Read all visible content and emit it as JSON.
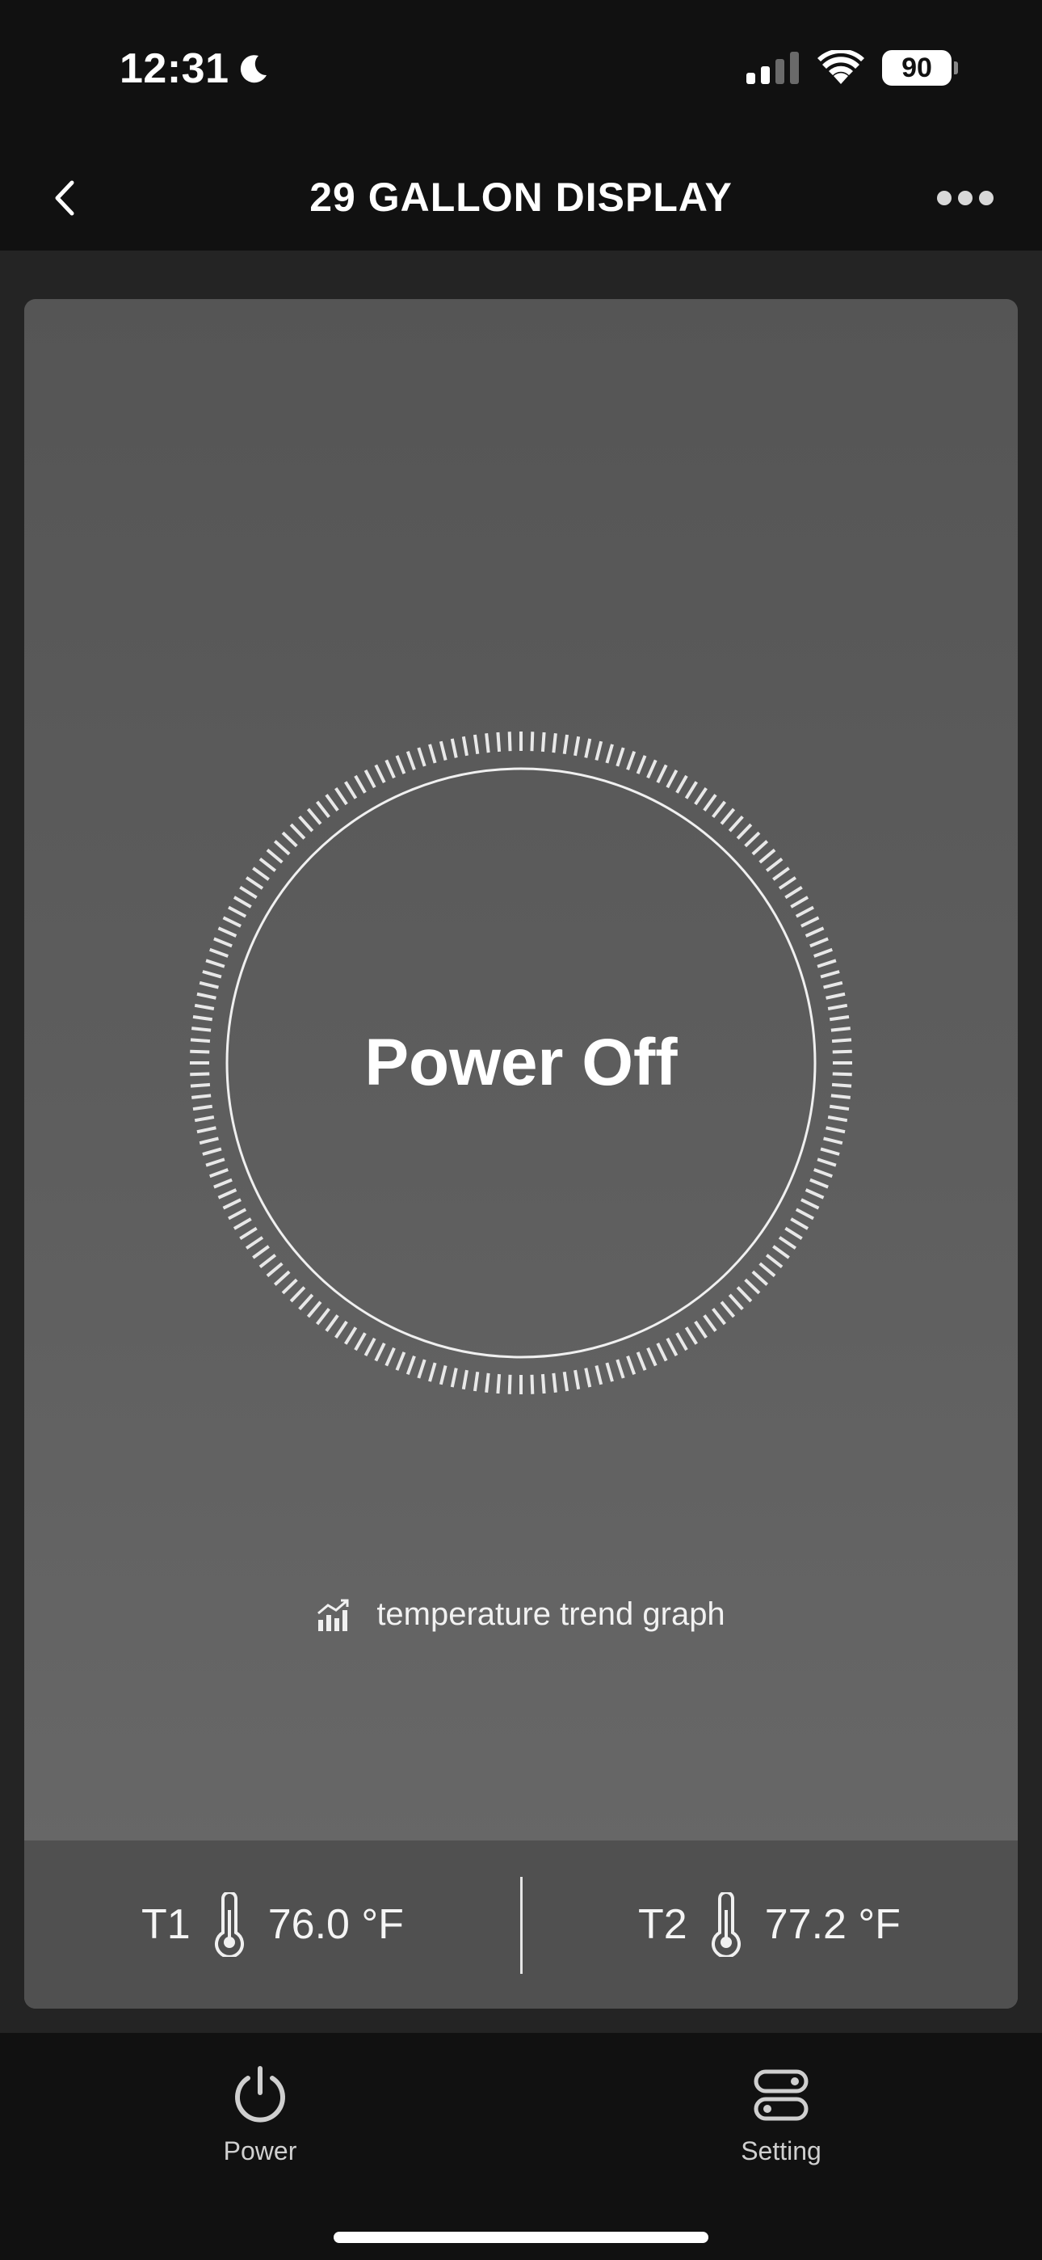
{
  "status_bar": {
    "time": "12:31",
    "moon_icon": "moon-icon",
    "signal_icon": "cellular-signal-icon",
    "wifi_icon": "wifi-icon",
    "battery_level": "90"
  },
  "nav": {
    "back_icon": "chevron-left-icon",
    "title": "29 GALLON DISPLAY",
    "more_icon": "more-dots-icon"
  },
  "dial": {
    "status": "Power Off"
  },
  "trend": {
    "icon": "trend-graph-icon",
    "label": "temperature trend graph"
  },
  "temperatures": [
    {
      "name": "T1",
      "icon": "thermometer-icon",
      "value": "76.0 °F"
    },
    {
      "name": "T2",
      "icon": "thermometer-icon",
      "value": "77.2 °F"
    }
  ],
  "tabs": [
    {
      "label": "Power",
      "icon": "power-icon"
    },
    {
      "label": "Setting",
      "icon": "settings-toggles-icon"
    }
  ],
  "colors": {
    "background": "#111111",
    "content_background": "#242424",
    "card_top": "#555555",
    "card_bottom": "#696969",
    "temp_panel": "#505050",
    "text": "#ffffff"
  }
}
